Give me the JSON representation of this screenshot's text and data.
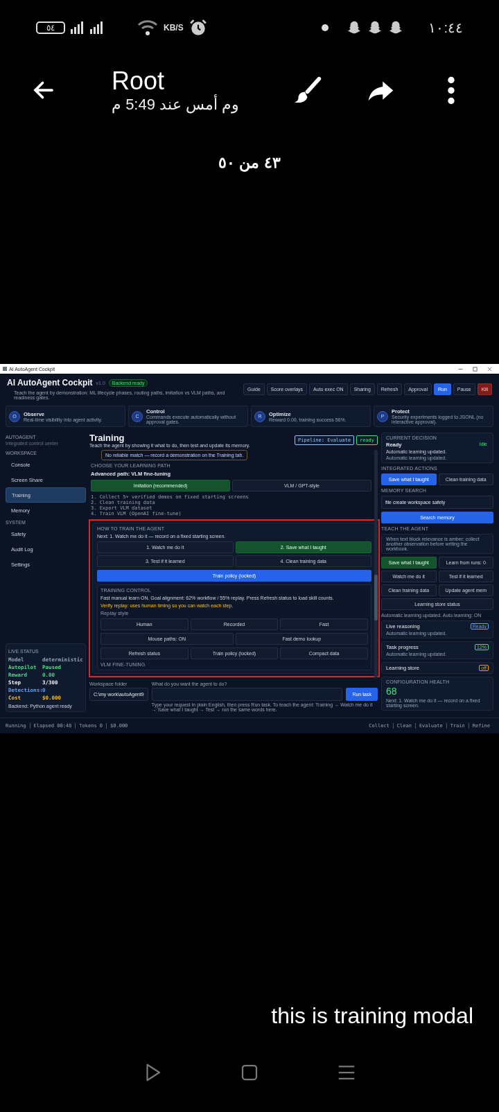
{
  "status_bar": {
    "battery": "٥٤",
    "speed": "KB/S",
    "time": "١٠:٤٤"
  },
  "viewer": {
    "title": "Root",
    "subtitle": "وم أمس عند 5:49 م",
    "counter": "٤٣ من ٥٠"
  },
  "screenshot": {
    "window_title": "AI AutoAgent Cockpit",
    "app": {
      "name": "AI AutoAgent Cockpit",
      "version": "v1.0",
      "badge": "Backend ready",
      "tagline": "Teach the agent by demonstration: ML lifecycle phases, routing paths, imitation vs VLM paths, and readiness gates."
    },
    "toolbar": [
      {
        "label": "Guide",
        "kind": "default"
      },
      {
        "label": "Score overlays",
        "kind": "default"
      },
      {
        "label": "Auto exec ON",
        "kind": "default"
      },
      {
        "label": "Sharing",
        "kind": "default"
      },
      {
        "label": "Refresh",
        "kind": "default"
      },
      {
        "label": "Approval",
        "kind": "default"
      },
      {
        "label": "Run",
        "kind": "primary"
      },
      {
        "label": "Pause",
        "kind": "default"
      },
      {
        "label": "Kill",
        "kind": "danger"
      }
    ],
    "features": [
      {
        "letter": "O",
        "title": "Observe",
        "text": "Real-time visibility into agent activity."
      },
      {
        "letter": "C",
        "title": "Control",
        "text": "Commands execute automatically without approval gates."
      },
      {
        "letter": "R",
        "title": "Optimize",
        "text": "Reward 0.00, training success 56%."
      },
      {
        "letter": "P",
        "title": "Protect",
        "text": "Security experiments logged to JSONL (no interactive approval)."
      }
    ],
    "sidebar": {
      "brand": "AUTOAGENT",
      "brand_sub": "Integrated control center",
      "sections": [
        {
          "title": "WORKSPACE",
          "items": [
            {
              "label": "Console",
              "selected": false
            },
            {
              "label": "Screen Share",
              "selected": false
            },
            {
              "label": "Training",
              "selected": true
            },
            {
              "label": "Memory",
              "selected": false
            }
          ]
        },
        {
          "title": "SYSTEM",
          "items": [
            {
              "label": "Safety",
              "selected": false
            },
            {
              "label": "Audit Log",
              "selected": false
            },
            {
              "label": "Settings",
              "selected": false
            }
          ]
        }
      ],
      "live_status": {
        "title": "LIVE STATUS",
        "rows": [
          {
            "label": "Model",
            "value": "deterministic",
            "color": "#94a3b8"
          },
          {
            "label": "Autopilot",
            "value": "Paused",
            "color": "#4ade80"
          },
          {
            "label": "Reward",
            "value": "0.00",
            "color": "#4ade80"
          },
          {
            "label": "Step",
            "value": "3/300",
            "color": "#f1f5f9"
          },
          {
            "label": "Detections:",
            "value": "0",
            "color": "#60a5fa"
          },
          {
            "label": "Cost",
            "value": "$0.000",
            "color": "#fbbf24"
          }
        ],
        "footer": "Backend: Python agent ready"
      }
    },
    "center": {
      "title": "Training",
      "subtitle": "Teach the agent by showing it what to do, then test and update its memory.",
      "badges": [
        {
          "text": "Pipeline: Evaluate",
          "color": "#93c5fd"
        },
        {
          "text": "ready",
          "color": "#4ade80"
        }
      ],
      "match_note": "No reliable match — record a demonstration on the Training tab.",
      "path": {
        "heading": "CHOOSE YOUR LEARNING PATH",
        "subheading": "Advanced path: VLM fine-tuning",
        "options": [
          {
            "label": "Imitation (recommended)",
            "selected": true
          },
          {
            "label": "VLM / GPT-style",
            "selected": false
          }
        ],
        "steps": [
          "1. Collect 5+ verified demos on fixed starting screens",
          "2. Clean training data",
          "3. Export VLM dataset",
          "4. Train VLM (OpenAI fine-tune)"
        ]
      },
      "how_to": {
        "heading": "HOW TO TRAIN THE AGENT",
        "next": "Next: 1. Watch me do it — record on a fixed starting screen.",
        "steps": [
          {
            "label": "1. Watch me do it",
            "kind": "default"
          },
          {
            "label": "2. Save what I taught",
            "kind": "success"
          },
          {
            "label": "3. Test if it learned",
            "kind": "default"
          },
          {
            "label": "4. Clean training data",
            "kind": "default"
          }
        ],
        "train": "Train policy (locked)"
      },
      "training_control": {
        "heading": "TRAINING CONTROL",
        "text": "Fast manual learn ON. Goal alignment: 62% workflow / 55% replay. Press Refresh status to load skill counts.",
        "warning": "Verify replay: uses human timing so you can watch each step.",
        "replay_label": "Replay style",
        "rows": [
          {
            "buttons": [
              "Human",
              "Recorded",
              "Fast"
            ]
          },
          {
            "buttons": [
              "Mouse paths: ON",
              "Fast demo lookup"
            ]
          },
          {
            "buttons": [
              "Refresh status",
              "Train policy (locked)",
              "Compact data"
            ]
          }
        ]
      },
      "vlm_heading": "VLM FINE-TUNING"
    },
    "task": {
      "folder_label": "Workspace folder",
      "folder": "C:\\my work\\autoAgent9",
      "prompt_label": "What do you want the agent to do?",
      "run": "Run task",
      "hint": "Type your request in plain English, then press Run task. To teach the agent: Training → Watch me do it → Save what I taught → Test → run the same words here."
    },
    "right": {
      "decision": {
        "heading": "CURRENT DECISION",
        "state": "Ready",
        "badge": "Idle",
        "text": "Automatic learning updated.",
        "note": "Automatic learning updated."
      },
      "actions": {
        "heading": "INTEGRATED ACTIONS",
        "buttons": [
          {
            "label": "Save what I taught",
            "kind": "primary"
          },
          {
            "label": "Clean training data",
            "kind": "default"
          }
        ]
      },
      "memory": {
        "heading": "MEMORY SEARCH",
        "query": "file create workspace safety",
        "button": "Search memory"
      },
      "teach": {
        "heading": "TEACH THE AGENT",
        "tip": "When text block relevance is amber: collect another observation before writing the workbook.",
        "buttons": [
          {
            "label": "Save what I taught",
            "kind": "success"
          },
          {
            "label": "Learn from runs: 0",
            "kind": "default"
          },
          {
            "label": "Watch me do it",
            "kind": "default"
          },
          {
            "label": "Test if it learned",
            "kind": "default"
          },
          {
            "label": "Clean training data",
            "kind": "default"
          },
          {
            "label": "Update agent mem",
            "kind": "default"
          },
          {
            "label": "Learning store status",
            "kind": "default"
          }
        ],
        "status": "Automatic learning updated. Auto learning: ON"
      },
      "cards": [
        {
          "title": "Live reasoning",
          "badge": "Ready",
          "color": "#60a5fa",
          "text": "Automatic learning updated."
        },
        {
          "title": "Task progress",
          "badge": "12%",
          "color": "#4ade80",
          "text": "Automatic learning updated."
        },
        {
          "title": "Learning store",
          "badge": "off",
          "color": "#f59e0b"
        }
      ],
      "health": {
        "heading": "CONFIGURATION HEALTH",
        "score": "68",
        "text": "Next: 1. Watch me do it — record on a fixed starting screen."
      }
    },
    "footer": {
      "status": [
        "Running",
        "Elapsed 00:48",
        "Tokens 0",
        "$0.000"
      ],
      "phases": [
        "Collect",
        "Clean",
        "Evaluate",
        "Train",
        "Refine"
      ]
    }
  },
  "caption": "this is training modal"
}
